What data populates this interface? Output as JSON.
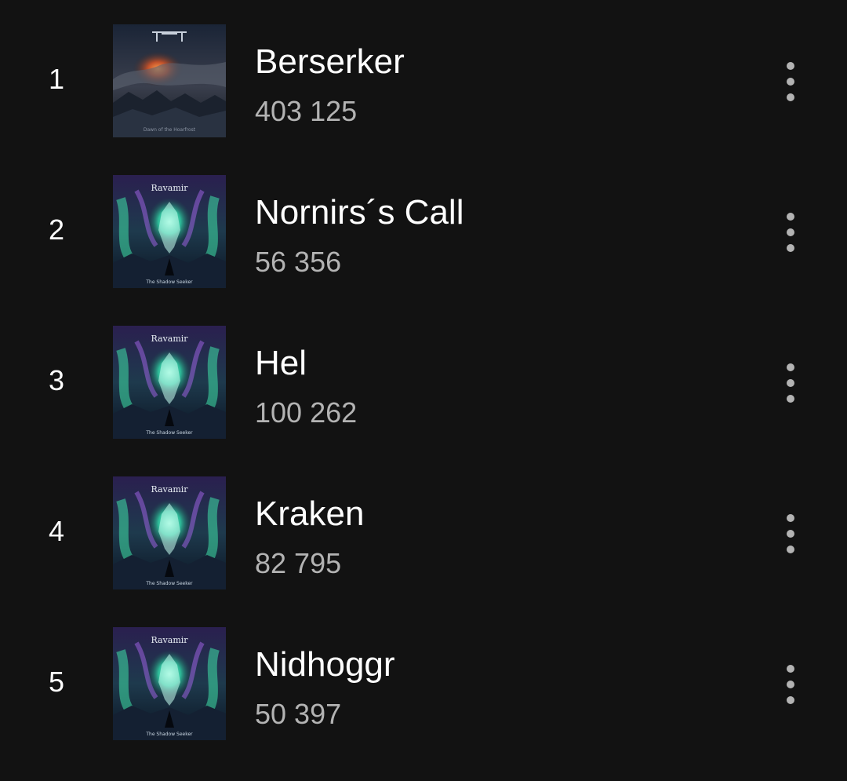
{
  "tracks": [
    {
      "rank": "1",
      "title": "Berserker",
      "plays": "403 125",
      "cover": "cover-storm",
      "cover_caption": "Dawn of the Hoarfrost"
    },
    {
      "rank": "2",
      "title": "Nornirs´s Call",
      "plays": "56 356",
      "cover": "cover-aurora-wolf",
      "cover_logo": "Ravamir",
      "cover_caption": "The Shadow Seeker"
    },
    {
      "rank": "3",
      "title": "Hel",
      "plays": "100 262",
      "cover": "cover-aurora-wolf",
      "cover_logo": "Ravamir",
      "cover_caption": "The Shadow Seeker"
    },
    {
      "rank": "4",
      "title": "Kraken",
      "plays": "82 795",
      "cover": "cover-aurora-wolf",
      "cover_logo": "Ravamir",
      "cover_caption": "The Shadow Seeker"
    },
    {
      "rank": "5",
      "title": "Nidhoggr",
      "plays": "50 397",
      "cover": "cover-aurora-wolf",
      "cover_logo": "Ravamir",
      "cover_caption": "The Shadow Seeker"
    }
  ],
  "icons": {
    "more": "more-vertical-icon"
  },
  "colors": {
    "background": "#121212",
    "title": "#ffffff",
    "subtitle": "#b3b3b3",
    "icon": "#b3b3b3"
  }
}
